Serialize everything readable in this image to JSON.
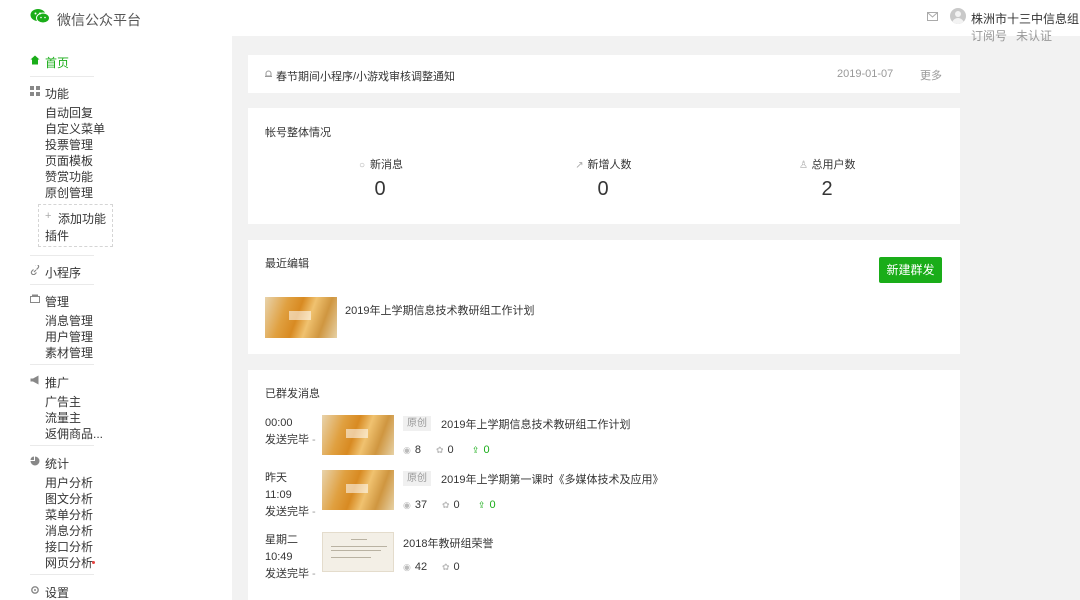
{
  "header": {
    "brand": "微信公众平台",
    "account_name": "株洲市十三中信息组",
    "account_type": "订阅号",
    "verify_status": "未认证",
    "more_glyph": "·"
  },
  "sidebar": {
    "home": "首页",
    "groups": [
      {
        "icon": "grid-icon",
        "title": "功能",
        "items": [
          "自动回复",
          "自定义菜单",
          "投票管理",
          "页面模板",
          "赞赏功能",
          "原创管理"
        ]
      },
      {
        "icon": "link-icon",
        "title": "小程序",
        "items": []
      },
      {
        "icon": "folder-icon",
        "title": "管理",
        "items": [
          "消息管理",
          "用户管理",
          "素材管理"
        ]
      },
      {
        "icon": "megaphone-icon",
        "title": "推广",
        "items": [
          "广告主",
          "流量主",
          "返佣商品..."
        ]
      },
      {
        "icon": "pie-chart-icon",
        "title": "统计",
        "items": [
          "用户分析",
          "图文分析",
          "菜单分析",
          "消息分析",
          "接口分析",
          "网页分析"
        ]
      },
      {
        "icon": "gear-icon",
        "title": "设置",
        "items": []
      }
    ],
    "add_feature": {
      "plus": "+",
      "label": "添加功能",
      "plugin": "插件"
    }
  },
  "notice": {
    "text": "春节期间小程序/小游戏审核调整通知",
    "date": "2019-01-07",
    "more": "更多"
  },
  "overview": {
    "title": "帐号整体情况",
    "stats": [
      {
        "icon": "message-icon",
        "glyph": "○",
        "label": "新消息",
        "value": "0"
      },
      {
        "icon": "trend-icon",
        "glyph": "↗",
        "label": "新增人数",
        "value": "0"
      },
      {
        "icon": "user-icon",
        "glyph": "♙",
        "label": "总用户数",
        "value": "2"
      }
    ]
  },
  "recent": {
    "title": "最近编辑",
    "new_button": "新建群发",
    "article_title": "2019年上学期信息技术教研组工作计划"
  },
  "sent": {
    "title": "已群发消息",
    "rows": [
      {
        "time_lines": [
          "00:00",
          "发送完毕"
        ],
        "tag": "原创",
        "title": "2019年上学期信息技术教研组工作计划",
        "views": "8",
        "likes": "0",
        "shares": "0"
      },
      {
        "time_lines": [
          "昨天",
          "11:09",
          "发送完毕"
        ],
        "tag": "原创",
        "title": "2019年上学期第一课时《多媒体技术及应用》",
        "views": "37",
        "likes": "0",
        "shares": "0"
      },
      {
        "time_lines": [
          "星期二",
          "10:49",
          "发送完毕"
        ],
        "tag": "",
        "title": "2018年教研组荣誉",
        "views": "42",
        "likes": "0",
        "shares": ""
      }
    ]
  },
  "colors": {
    "accent": "#1aad19",
    "background": "#f2f2f2",
    "panel": "#ffffff",
    "alert": "#e64340"
  }
}
